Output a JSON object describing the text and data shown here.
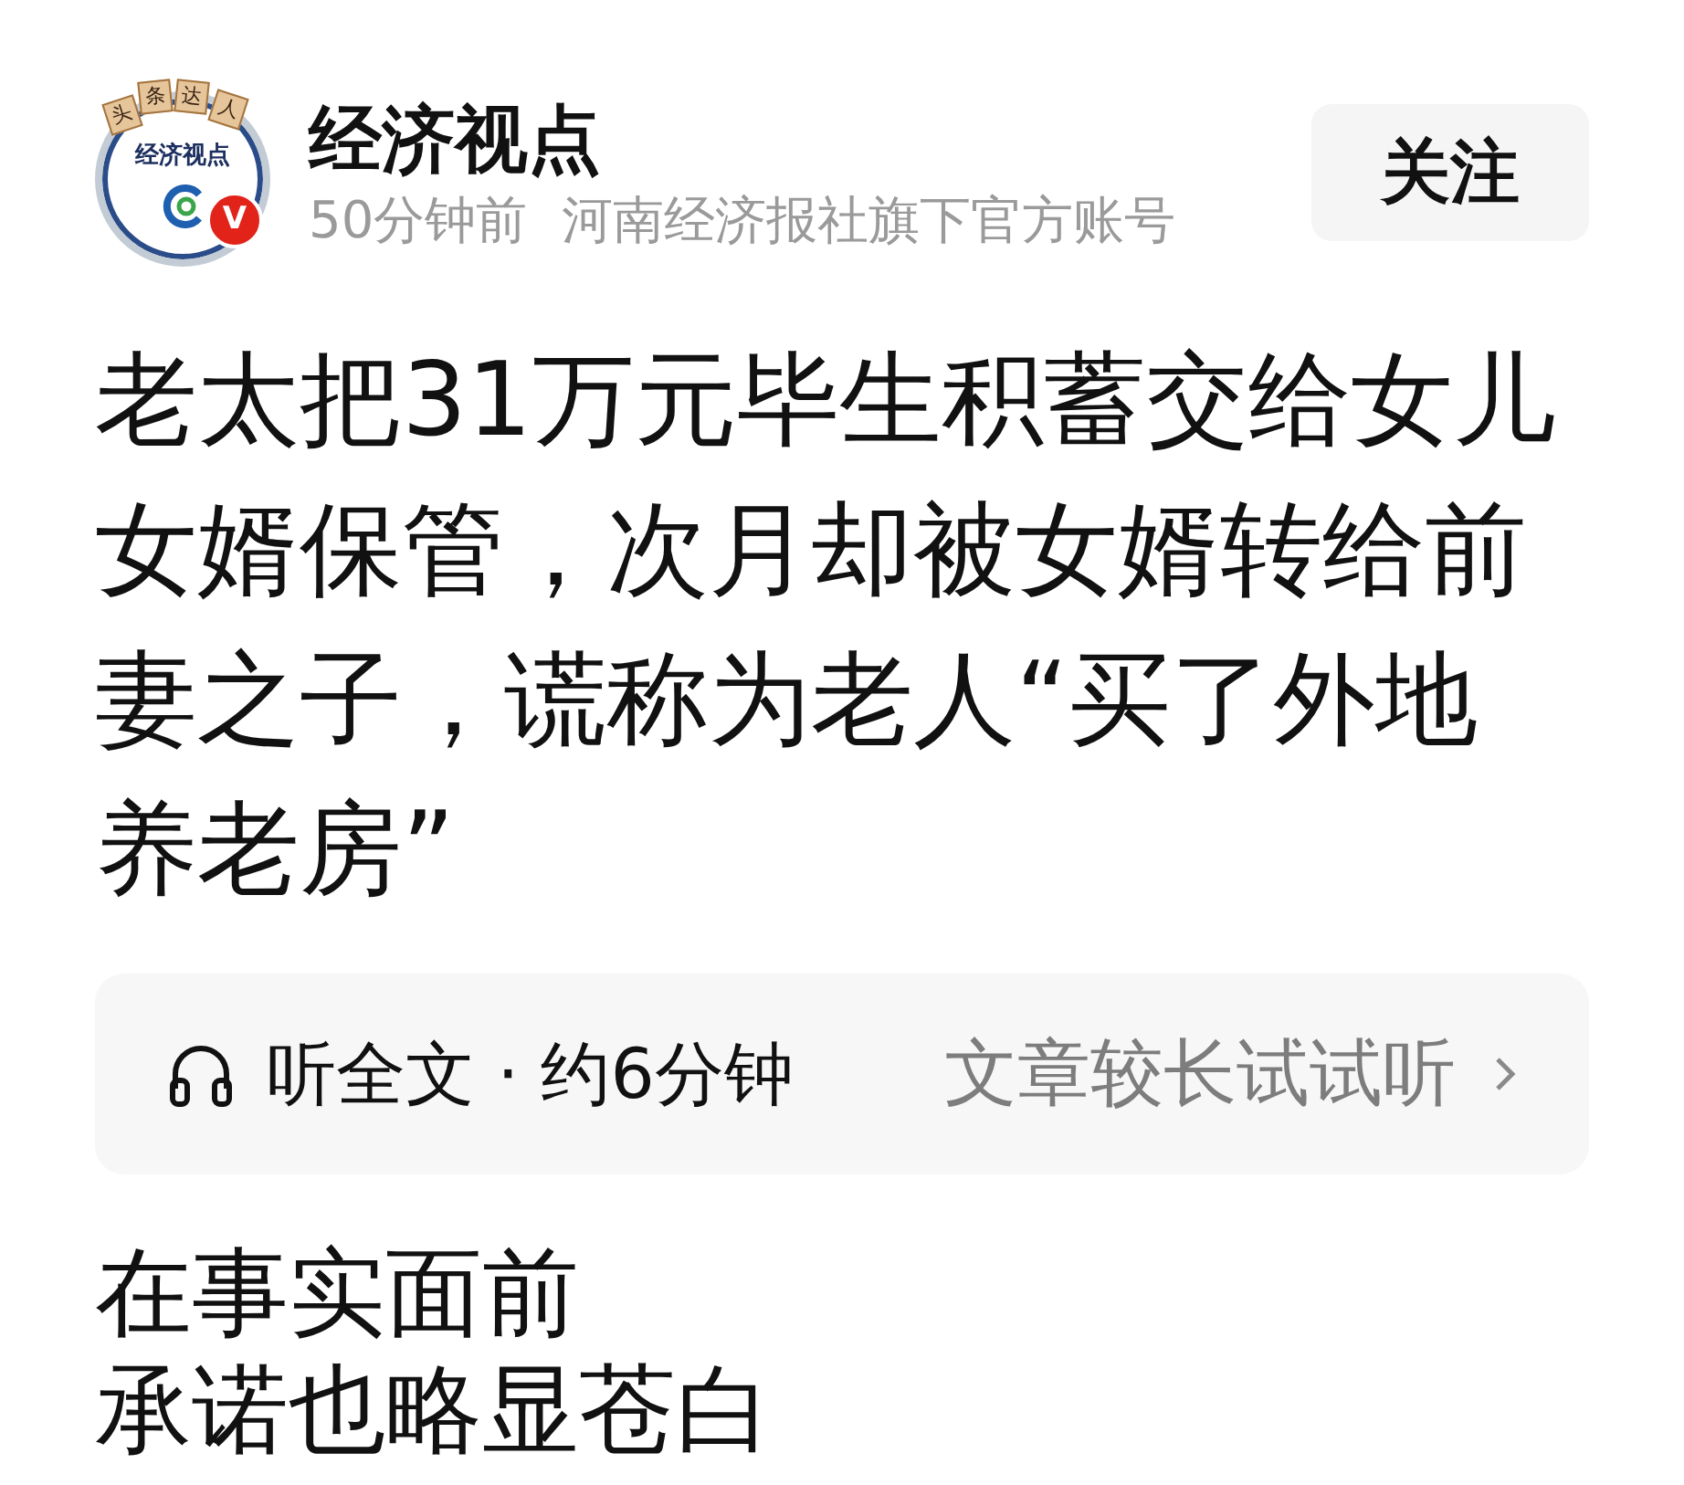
{
  "author": {
    "avatar": {
      "logo_text": "经济视点",
      "banner_text": "头条达人",
      "badge": "V"
    },
    "name": "经济视点",
    "time": "50分钟前",
    "description": "河南经济报社旗下官方账号"
  },
  "follow_button": {
    "label": "关注"
  },
  "article": {
    "title": "老太把31万元毕生积蓄交给女儿女婿保管，次月却被女婿转给前妻之子，谎称为老人“买了外地养老房”",
    "listen_bar": {
      "label": "听全文 · 约6分钟",
      "hint": "文章较长试试听"
    },
    "paragraphs": [
      "在事实面前",
      "承诺也略显苍白"
    ]
  }
}
